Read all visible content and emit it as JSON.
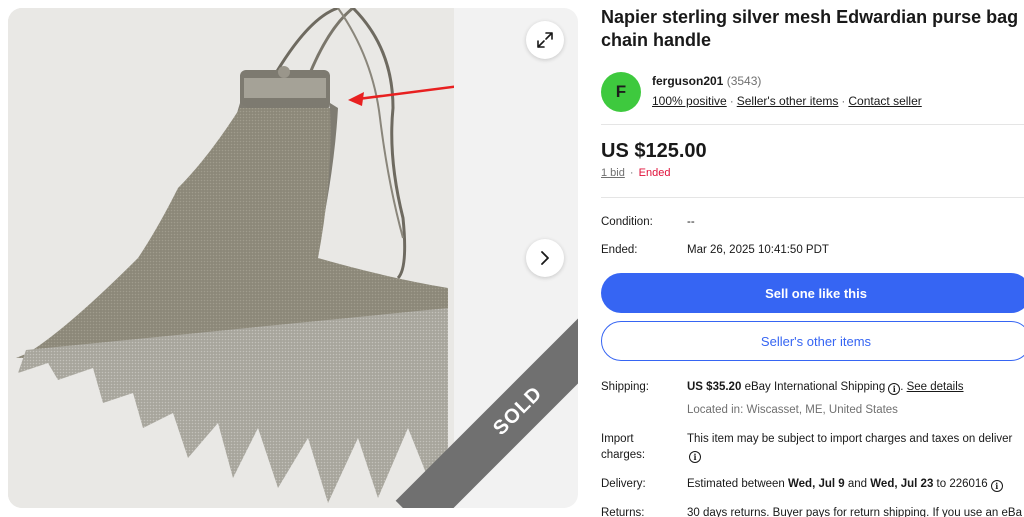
{
  "gallery": {
    "sold_badge": "SOLD",
    "icons": {
      "expand": "expand-arrows-icon",
      "next": "chevron-right-icon"
    }
  },
  "listing": {
    "title": "Napier sterling silver mesh Edwardian purse bag chain handle"
  },
  "seller": {
    "avatar_letter": "F",
    "avatar_color": "#3ec93e",
    "name": "ferguson201",
    "score": "(3543)",
    "positive": "100% positive",
    "other_items": "Seller's other items",
    "contact": "Contact seller"
  },
  "price": {
    "amount": "US $125.00",
    "bids": "1 bid",
    "separator": "·",
    "status": "Ended"
  },
  "details": {
    "condition_label": "Condition:",
    "condition_value": "--",
    "ended_label": "Ended:",
    "ended_value": "Mar 26, 2025 10:41:50 PDT"
  },
  "buttons": {
    "sell_one": "Sell one like this",
    "sellers_other": "Seller's other items"
  },
  "shipping": {
    "label": "Shipping:",
    "cost": "US $35.20",
    "method": "eBay International Shipping",
    "see_details": "See details",
    "location": "Located in: Wiscasset, ME, United States"
  },
  "import": {
    "label_line1": "Import",
    "label_line2": "charges:",
    "text": "This item may be subject to import charges and taxes on deliver"
  },
  "delivery": {
    "label": "Delivery:",
    "prefix": "Estimated between",
    "start": "Wed, Jul 9",
    "and": "and",
    "end": "Wed, Jul 23",
    "to": "to 226016"
  },
  "returns": {
    "label": "Returns:",
    "text": "30 days returns. Buyer pays for return shipping. If you use an eBa"
  },
  "colors": {
    "accent": "#3665f3",
    "ended": "#e0103a",
    "muted": "#707070"
  }
}
